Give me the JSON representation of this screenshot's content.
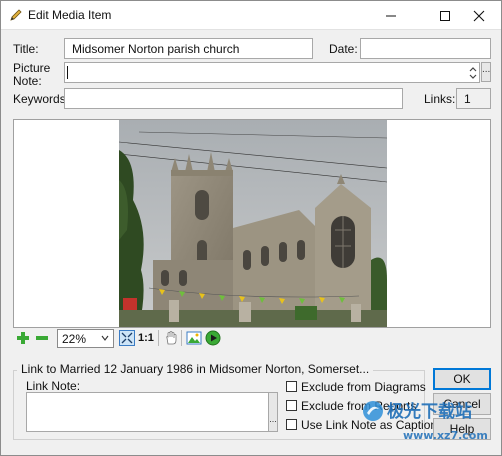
{
  "window": {
    "title": "Edit Media Item",
    "minimize_glyph": "—",
    "maximize_glyph": "☐",
    "close_glyph": "✕"
  },
  "form": {
    "title_label": "Title:",
    "title_value": "Midsomer Norton parish church",
    "date_label": "Date:",
    "date_value": "",
    "picture_note_label_1": "Picture",
    "picture_note_label_2": "Note:",
    "picture_note_value": "",
    "ellipsis": "...",
    "keywords_label": "Keywords:",
    "keywords_value": "",
    "links_label": "Links:",
    "links_value": "1"
  },
  "image": {
    "subject": "church photograph"
  },
  "toolbar": {
    "zoom_value": "22%",
    "ratio_label": "1:1",
    "icons": [
      "zoom-in-icon",
      "zoom-out-icon",
      "fit-icon",
      "hand-icon",
      "image-edit-icon",
      "play-icon"
    ]
  },
  "link_group": {
    "title": "Link to Married 12 January 1986 in Midsomer Norton, Somerset...",
    "link_note_label": "Link Note:",
    "link_note_value": "",
    "ellipsis": "...",
    "exclude_diagrams_label": "Exclude from Diagrams",
    "exclude_reports_label": "Exclude from Reports",
    "use_link_note_label": "Use Link Note as Caption"
  },
  "buttons": {
    "ok": "OK",
    "cancel": "Cancel",
    "help": "Help"
  },
  "watermark": {
    "cn_text": "极光下载站",
    "url": "www.xz7.com"
  },
  "colors": {
    "accent": "#0078d7",
    "window_bg": "#f0f0f0",
    "green_icon": "#3aa935"
  }
}
